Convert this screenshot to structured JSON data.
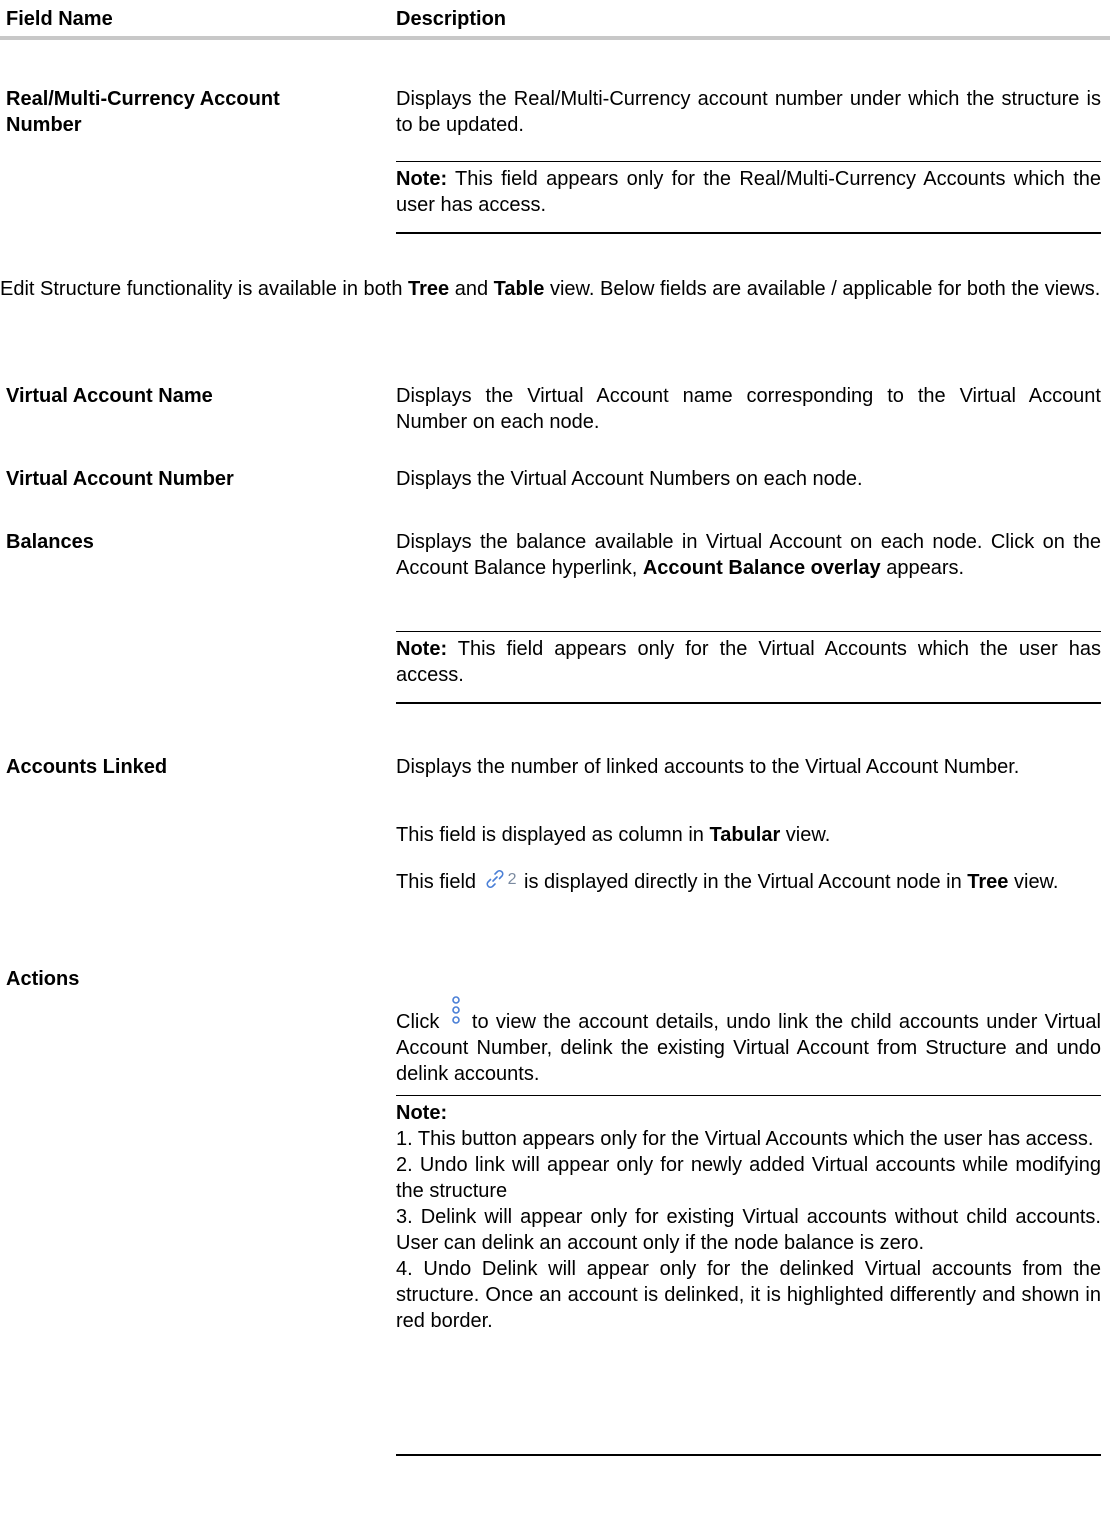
{
  "header": {
    "field_name": "Field Name",
    "description": "Description"
  },
  "real_account": {
    "name_line1": "Real/Multi-Currency Account",
    "name_line2": "Number",
    "desc": "Displays the Real/Multi-Currency account number under which the structure is to be updated.",
    "note_label": "Note:",
    "note_text": " This field appears only for the Real/Multi-Currency Accounts which the user has access."
  },
  "intro": {
    "part1": "Edit Structure functionality is available in both ",
    "tree": "Tree",
    "part2": " and ",
    "table": "Table",
    "part3": " view. Below fields are available / applicable for both the views."
  },
  "virtual_name": {
    "name": "Virtual Account Name",
    "desc": "Displays the Virtual Account name corresponding to the Virtual Account Number on each node."
  },
  "virtual_number": {
    "name": "Virtual Account Number",
    "desc": "Displays the Virtual Account Numbers on each node."
  },
  "balances": {
    "name": "Balances",
    "desc_part1": "Displays the balance available in Virtual Account on each node. Click on the Account Balance hyperlink, ",
    "desc_bold": "Account Balance overlay",
    "desc_part2": " appears.",
    "note_label": "Note:",
    "note_text": " This field appears only for the Virtual Accounts which the user has access."
  },
  "accounts_linked": {
    "name": "Accounts Linked",
    "desc": "Displays the number of linked accounts to the Virtual Account Number.",
    "tabular_part1": "This field is displayed as column in ",
    "tabular_bold": "Tabular",
    "tabular_part2": " view.",
    "tree_part1": "This field ",
    "icon_count": "2",
    "tree_part2": " is displayed directly in the Virtual Account node in ",
    "tree_bold": "Tree",
    "tree_part3": " view."
  },
  "actions": {
    "name": "Actions",
    "desc_part1": "Click ",
    "desc_part2": " to view the account details, undo link the child accounts under Virtual Account Number, delink the existing Virtual Account from Structure and undo delink accounts.",
    "note_label": "Note:",
    "notes": [
      "1. This button appears only for the Virtual Accounts which the user has access.",
      "2. Undo link will appear only for newly added Virtual accounts while modifying the structure",
      "3. Delink will appear only for existing Virtual accounts without child accounts. User can delink an account only if the node balance is zero.",
      "4. Undo Delink will appear only for the delinked Virtual accounts from the structure. Once an account is delinked, it is highlighted differently and shown in red border."
    ]
  },
  "icons": {
    "link": "link-icon",
    "kebab": "kebab-menu-icon",
    "icon_color": "#4a7fd6"
  }
}
